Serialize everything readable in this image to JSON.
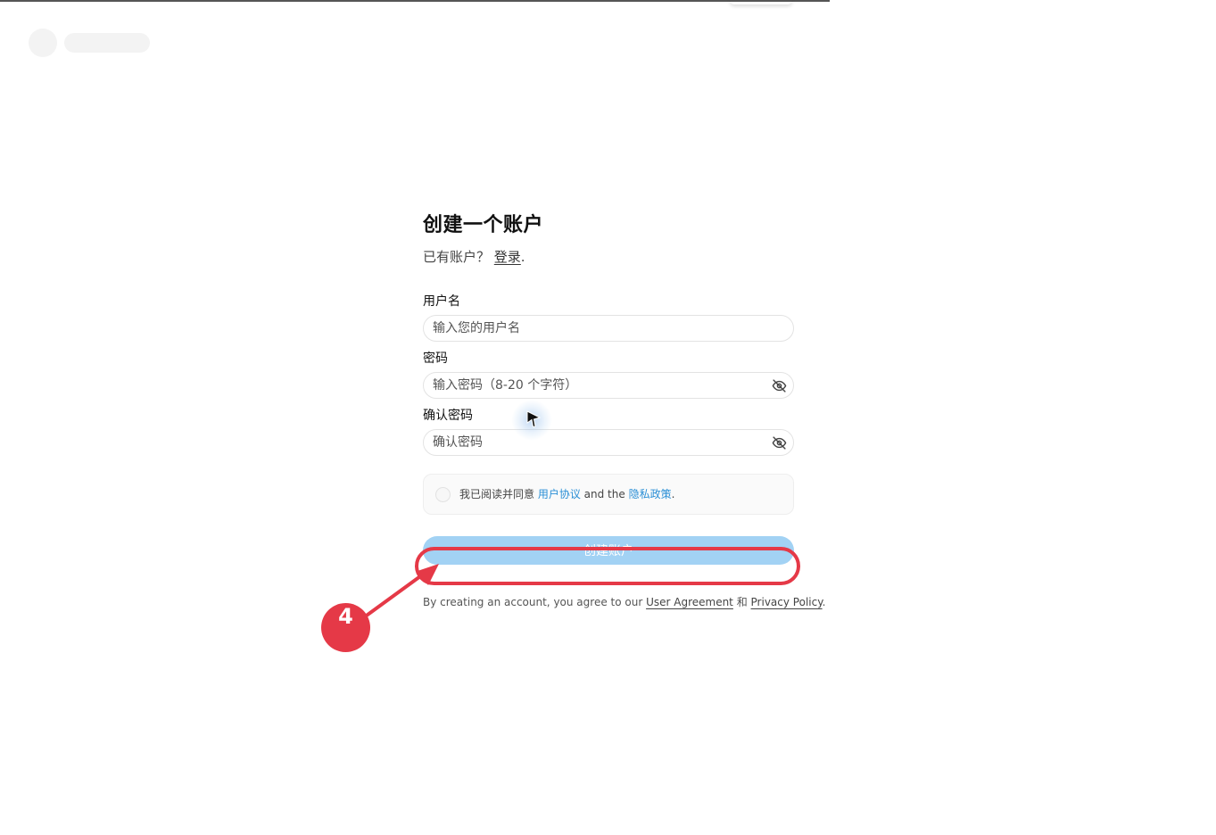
{
  "form": {
    "title": "创建一个账户",
    "subtitle_prefix": "已有账户？ ",
    "login_link": "登录",
    "subtitle_suffix": ".",
    "username": {
      "label": "用户名",
      "placeholder": "输入您的用户名",
      "value": ""
    },
    "password": {
      "label": "密码",
      "placeholder": "输入密码（8-20 个字符）",
      "value": "",
      "visibility_icon": "eye-off-icon"
    },
    "confirm_password": {
      "label": "确认密码",
      "placeholder": "确认密码",
      "value": "",
      "visibility_icon": "eye-off-icon"
    },
    "agreement": {
      "checked": false,
      "prefix": "我已阅读并同意 ",
      "user_agreement": "用户协议",
      "middle": " and the ",
      "privacy_policy": "隐私政策",
      "suffix": "."
    },
    "submit_label": "创建账户",
    "footnote": {
      "prefix": "By creating an account, you agree to our ",
      "user_agreement": "User Agreement",
      "middle": " 和 ",
      "privacy_policy": "Privacy Policy",
      "suffix": "."
    }
  },
  "annotation": {
    "step_number": "4",
    "color": "#e53947"
  },
  "colors": {
    "button_bg": "#a2d2f4",
    "link": "#2a8fd6"
  }
}
